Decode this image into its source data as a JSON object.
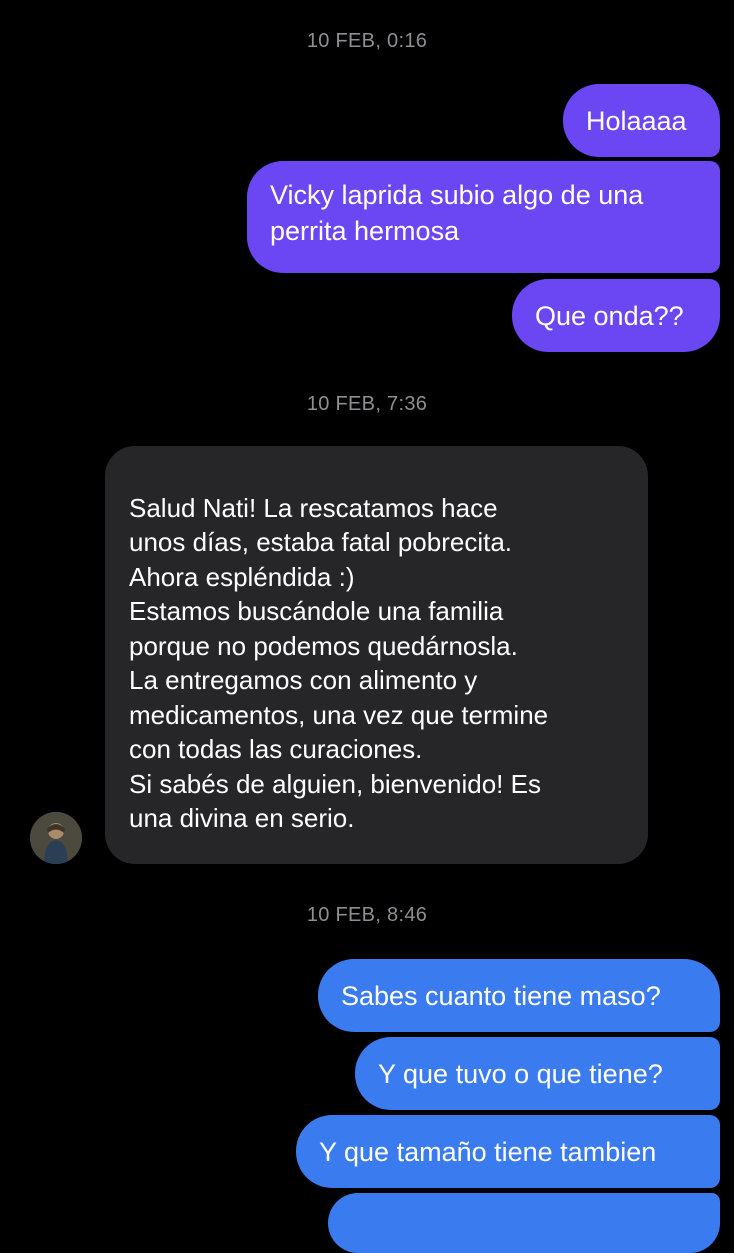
{
  "conversation": {
    "timestamps": [
      "10 FEB, 0:16",
      "10 FEB, 7:36",
      "10 FEB, 8:46"
    ],
    "group1": {
      "msg1": "Holaaaa",
      "msg2_line1": "Vicky laprida subio algo de una",
      "msg2_line2": "perrita hermosa",
      "msg3": "Que onda??"
    },
    "reply": {
      "line1": "Salud Nati! La rescatamos hace",
      "line2": "unos días, estaba fatal pobrecita.",
      "line3": "Ahora espléndida :)",
      "line4": "Estamos buscándole una familia",
      "line5": "porque no podemos quedárnosla.",
      "line6": "La entregamos con alimento y",
      "line7": "medicamentos, una vez que termine",
      "line8": "con todas las curaciones.",
      "line9": "Si sabés de alguien, bienvenido! Es",
      "line10": "una divina en serio."
    },
    "group3": {
      "msg1": "Sabes cuanto tiene maso?",
      "msg2": "Y que tuvo o que tiene?",
      "msg3": "Y que tamaño tiene tambien"
    }
  },
  "colors": {
    "background": "#000000",
    "outgoing_purple": "#6b46f3",
    "outgoing_blue": "#3b7bf0",
    "incoming": "#262628",
    "timestamp": "#8e8e93"
  }
}
